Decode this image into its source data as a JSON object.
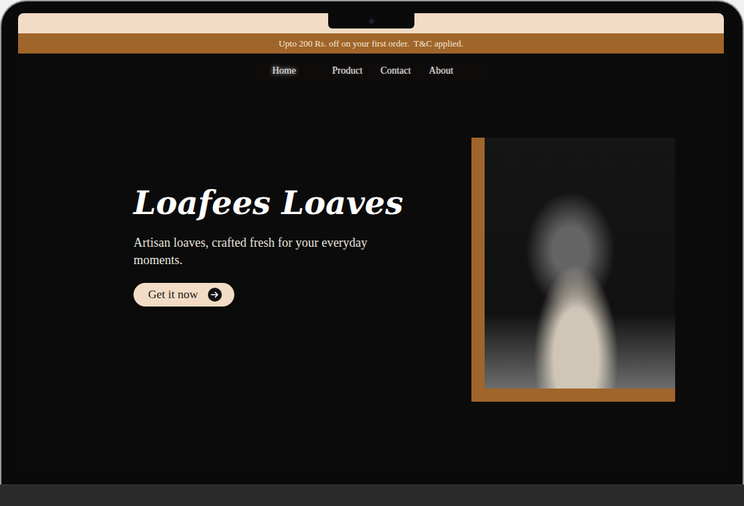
{
  "banner": {
    "text": "Upto 200 Rs. off on your first order.  T&C applied."
  },
  "nav": [
    {
      "label": "Home",
      "selected": true
    },
    {
      "label": "Product",
      "selected": false
    },
    {
      "label": "Contact",
      "selected": false
    },
    {
      "label": "About",
      "selected": false
    }
  ],
  "hero": {
    "title": "Loafees Loaves",
    "subtitle": "Artisan loaves, crafted fresh for your everyday moments.",
    "button": "Get it now"
  }
}
